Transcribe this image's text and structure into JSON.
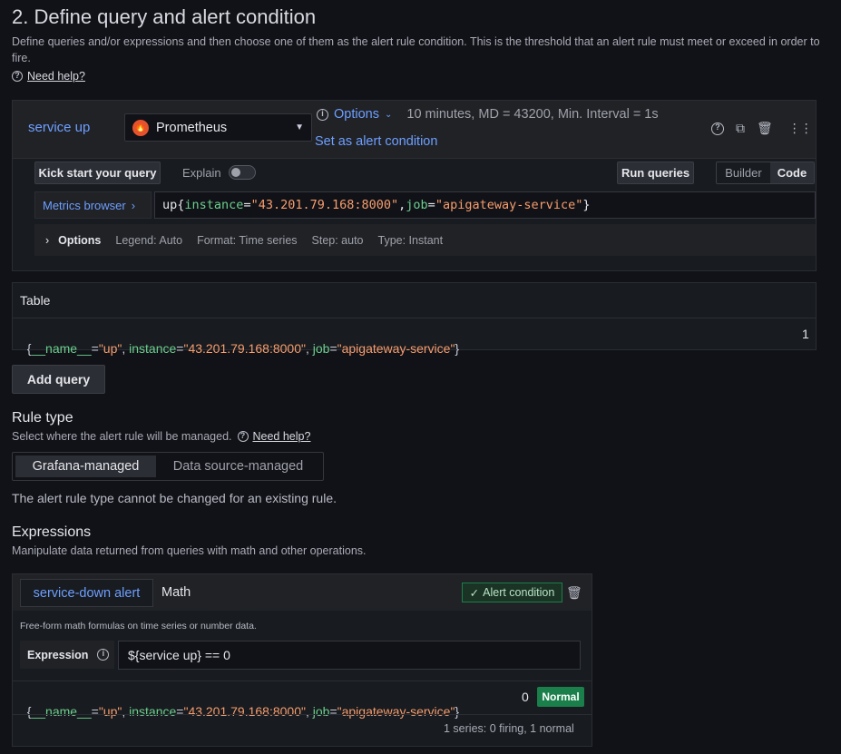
{
  "section": {
    "title": "2. Define query and alert condition",
    "description": "Define queries and/or expressions and then choose one of them as the alert rule condition. This is the threshold that an alert rule must meet or exceed in order to fire.",
    "help_label": "Need help?"
  },
  "query": {
    "name": "service up",
    "datasource": "Prometheus",
    "options_label": "Options",
    "options_summary": "10 minutes, MD = 43200, Min. Interval = 1s",
    "set_condition_label": "Set as alert condition",
    "kick_start_label": "Kick start your query",
    "explain_label": "Explain",
    "run_queries_label": "Run queries",
    "builder_label": "Builder",
    "code_label": "Code",
    "metrics_browser_label": "Metrics browser",
    "expr": {
      "metric": "up",
      "open": "{",
      "instance_key": "instance",
      "eq": "=",
      "instance_value": "\"43.201.79.168:8000\"",
      "comma": ",",
      "job_key": "job",
      "job_value": "\"apigateway-service\"",
      "close": "}"
    },
    "options_row": {
      "label": "Options",
      "legend": "Legend: Auto",
      "format": "Format: Time series",
      "step": "Step: auto",
      "type": "Type: Instant"
    }
  },
  "table": {
    "title": "Table",
    "row": {
      "open": "{",
      "name_key": "__name__",
      "name_value": "\"up\"",
      "sep": ", ",
      "instance_key": "instance",
      "instance_value": "\"43.201.79.168:8000\"",
      "job_key": "job",
      "job_value": "\"apigateway-service\"",
      "close": "}",
      "eq": "=",
      "value": "1"
    }
  },
  "add_query_label": "Add query",
  "rule_type": {
    "title": "Rule type",
    "description": "Select where the alert rule will be managed.",
    "help_label": "Need help?",
    "options": [
      "Grafana-managed",
      "Data source-managed"
    ],
    "note": "The alert rule type cannot be changed for an existing rule."
  },
  "expressions": {
    "title": "Expressions",
    "description": "Manipulate data returned from queries with math and other operations.",
    "card": {
      "name": "service-down alert",
      "type": "Math",
      "alert_condition_label": "Alert condition",
      "hint": "Free-form math formulas on time series or number data.",
      "expression_label": "Expression",
      "expression_value": "${service up} == 0",
      "result_value": "0",
      "status": "Normal",
      "footer": "1 series: 0 firing, 1 normal"
    }
  },
  "colors": {
    "link": "#6e9fff",
    "label_key": "#6ccf8e",
    "label_value": "#f79d6e",
    "normal_badge": "#1a7f4b"
  }
}
